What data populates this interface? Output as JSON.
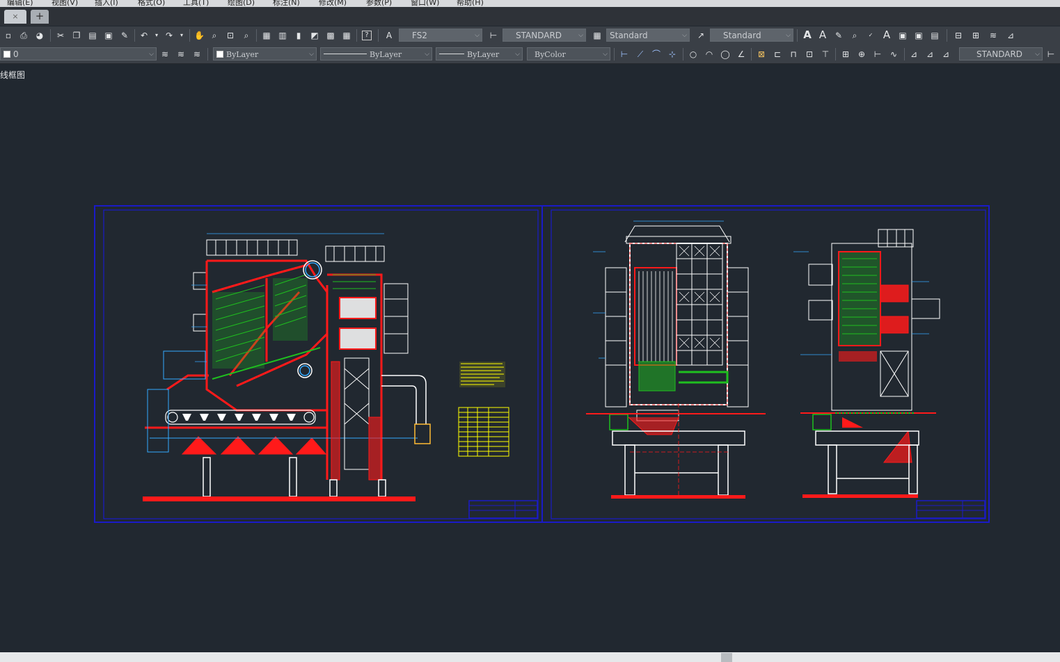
{
  "menubar": {
    "items": [
      "编辑(E)",
      "视图(V)",
      "插入(I)",
      "格式(O)",
      "工具(T)",
      "绘图(D)",
      "标注(N)",
      "修改(M)",
      "参数(P)",
      "窗口(W)",
      "帮助(H)"
    ]
  },
  "tabs": {
    "close_glyph": "×",
    "add_glyph": "+"
  },
  "toolbar1": {
    "text_style": "FS2",
    "dim_style": "STANDARD",
    "table_style": "Standard",
    "mleader_style": "Standard"
  },
  "toolbar2": {
    "layer": "0",
    "color": "ByLayer",
    "linetype": "ByLayer",
    "lineweight": "ByLayer",
    "plot_style": "ByColor",
    "dim_style": "STANDARD"
  },
  "viewport": {
    "label": "线框图",
    "background": "#212830"
  },
  "colors": {
    "frame": "#1a1ac8",
    "red": "#ff1a1a",
    "green": "#1fbf1f",
    "white": "#ffffff",
    "yellow": "#ffff00",
    "cyan": "#33aaff"
  },
  "icons": [
    "new-icon",
    "open-icon",
    "print-icon",
    "publish-icon",
    "cut-icon",
    "copy-icon",
    "paste-icon",
    "match-prop-icon",
    "brush-icon",
    "undo-icon",
    "redo-icon",
    "pan-icon",
    "zoom-icon",
    "zoom-window-icon",
    "zoom-prev-icon",
    "properties-icon",
    "design-center-icon",
    "tool-palette-icon",
    "sheet-set-icon",
    "markup-icon",
    "calculator-icon",
    "help-icon"
  ]
}
